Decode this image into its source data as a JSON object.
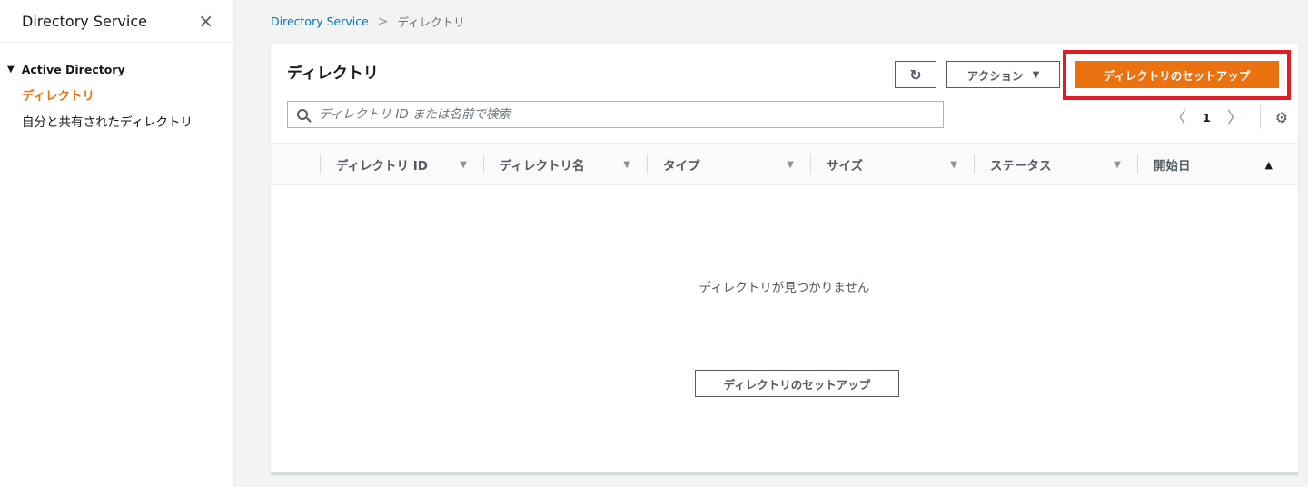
{
  "sidebar": {
    "title": "Directory Service",
    "close_icon": "×",
    "section": "Active Directory",
    "items": [
      {
        "label": "ディレクトリ"
      },
      {
        "label": "自分と共有されたディレクトリ"
      }
    ]
  },
  "breadcrumb": {
    "link": "Directory Service",
    "current": "ディレクトリ"
  },
  "panel": {
    "title": "ディレクトリ",
    "refresh_icon": "↻",
    "actions_label": "アクション",
    "actions_caret": "▼",
    "setup_label": "ディレクトリのセットアップ",
    "search_placeholder": "ディレクトリ ID または名前で検索",
    "page": "1",
    "prev": "〈",
    "next": "〉",
    "gear_icon": "⚙"
  },
  "table": {
    "columns": [
      {
        "label": "ディレクトリ ID",
        "sort": "▼"
      },
      {
        "label": "ディレクトリ名",
        "sort": "▼"
      },
      {
        "label": "タイプ",
        "sort": "▼"
      },
      {
        "label": "サイズ",
        "sort": "▼"
      },
      {
        "label": "ステータス",
        "sort": "▼"
      },
      {
        "label": "開始日",
        "sort": "▲"
      }
    ],
    "empty_message": "ディレクトリが見つかりません",
    "empty_button": "ディレクトリのセットアップ"
  },
  "colors": {
    "accent": "#ec7211",
    "link": "#0073bb",
    "highlight": "#e41b23"
  }
}
